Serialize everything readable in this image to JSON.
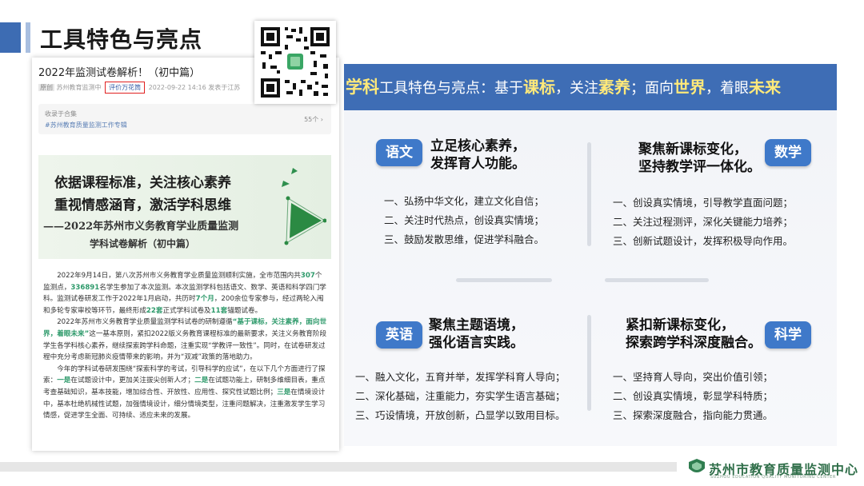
{
  "slide_title": "工具特色与亮点",
  "article": {
    "title": "2022年监测试卷解析！（初中篇）",
    "meta_tag": "原创",
    "meta_source": "苏州教育监测中",
    "meta_account": "评价万花筒",
    "meta_date": "2022-09-22 14:16",
    "meta_location": "发表于江苏",
    "collection_label": "收录于合集",
    "collection_name": "#苏州教育质量监测工作专辑",
    "collection_count": "55个 ›",
    "banner_line1": "依据课程标准，关注核心素养",
    "banner_line2": "重视情感涵育，激活学科思维",
    "banner_line3": "——2022年苏州市义务教育学业质量监测",
    "banner_line4": "学科试卷解析（初中篇）",
    "p1_a": "2022年9月14日，第八次苏州市义务教育学业质量监测顺利实施，全市范围内共",
    "p1_n1": "307",
    "p1_b": "个监测点，",
    "p1_n2": "336891",
    "p1_c": "名学生参加了本次监测。本次监测学科包括语文、数学、英语和科学四门学科。监测试卷研发工作于2022年1月启动，共历时",
    "p1_n3": "7个月",
    "p1_d": "，200余位专家参与，经过两轮入闱和多轮专家审校等环节，最终形成",
    "p1_n4": "22套",
    "p1_e": "正式学科试卷及",
    "p1_n5": "11套",
    "p1_f": "锚题试卷。",
    "p2_a": "2022年苏州市义务教育学业质量监测学科试卷的研制遵循",
    "p2_hl": "“基于课标，关注素养，面向世界，着眼未来”",
    "p2_b": "这一基本原则，紧扣2022版义务教育课程标准的最新要求，关注义务教育阶段学生各学科核心素养，继续探索跨学科命题，注重实现“学教评一致性”。同时，在试卷研发过程中充分考虑新冠肺炎疫情带来的影响，并为“双减”政策的落地助力。",
    "p3_a": "今年的学科试卷研发围绕“探索科学的考试，引导科学的应试”，在以下几个方面进行了探索：",
    "p3_k1": "一是",
    "p3_b": "在试题设计中，更加关注拔尖创新人才；",
    "p3_k2": "二是",
    "p3_c": "在试题功能上，研制多维细目表，重点考查基础知识，基本技能，增加综合性、开放性、应用性、探究性试题比例；",
    "p3_k3": "三是",
    "p3_d": "在情境设计中，基本杜绝机械性试题，加强情境设计，细分情境类型，注重问题解决，注重激发学生学习情感，促进学生全面、可持续、适应未来的发展。"
  },
  "panel": {
    "title_pre1": "学科",
    "title_pre2": "工具特色与亮点：基于",
    "title_k1": "课标",
    "title_m1": "，关注",
    "title_k2": "素养",
    "title_m2": "；面向",
    "title_k3": "世界",
    "title_m3": "，着眼",
    "title_k4": "未来",
    "subjects": [
      {
        "badge": "语文",
        "head1": "立足核心素养，",
        "head2": "发挥育人功能。",
        "items": [
          "一、弘扬中华文化，建立文化自信；",
          "二、关注时代热点，创设真实情境；",
          "三、鼓励发散思维，促进学科融合。"
        ]
      },
      {
        "badge": "数学",
        "head1": "聚焦新课标变化，",
        "head2": "坚持教学评一体化。",
        "items": [
          "一、创设真实情境，引导教学直面问题；",
          "二、关注过程测评，深化关键能力培养；",
          "三、创新试题设计，发挥积极导向作用。"
        ]
      },
      {
        "badge": "英语",
        "head1": "聚焦主题语境，",
        "head2": "强化语言实践。",
        "items": [
          "一、融入文化，五育并举，发挥学科育人导向；",
          "二、深化基础，注重能力，夯实学生语言基础；",
          "三、巧设情境，开放创新，凸显学以致用目标。"
        ]
      },
      {
        "badge": "科学",
        "head1": "紧扣新课标变化，",
        "head2": "探索跨学科深度融合。",
        "items": [
          "一、坚持育人导向，突出价值引领；",
          "二、创设真实情境，彰显学科特质；",
          "三、探索深度融合，指向能力贯通。"
        ]
      }
    ]
  },
  "footer": {
    "org_cn": "苏州市教育质量监测中心",
    "org_en": "SUZHOU EDUCATION QUALITY MONITORING CENTER"
  },
  "colors": {
    "brand_blue": "#3e6db5",
    "badge_blue": "#3f79c9",
    "highlight_yellow": "#ffe97a",
    "green": "#2e9a6b"
  }
}
